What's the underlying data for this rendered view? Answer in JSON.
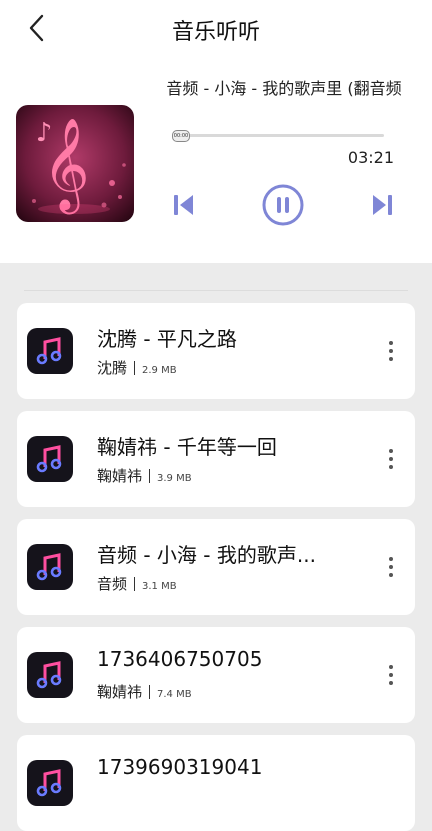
{
  "header": {
    "title": "音乐听听"
  },
  "player": {
    "song_title": "音频 - 小海 - 我的歌声里 (翻音频",
    "elapsed": "00:00",
    "duration": "03:21",
    "progress": 0.02,
    "accent_color": "#7f86d6"
  },
  "songs": [
    {
      "title": "沈腾 - 平凡之路",
      "artist": "沈腾",
      "size": "2.9 MB"
    },
    {
      "title": "鞠婧祎 - 千年等一回",
      "artist": "鞠婧祎",
      "size": "3.9 MB"
    },
    {
      "title": "音频 - 小海 - 我的歌声...",
      "artist": "音频",
      "size": "3.1 MB"
    },
    {
      "title": "1736406750705",
      "artist": "鞠婧祎",
      "size": "7.4 MB"
    },
    {
      "title": "1739690319041",
      "artist": "",
      "size": ""
    }
  ],
  "icons": {
    "back": "chevron-left-icon",
    "prev": "skip-previous-icon",
    "pause": "pause-icon",
    "next": "skip-next-icon",
    "more": "more-vertical-icon",
    "song": "music-note-icon"
  }
}
